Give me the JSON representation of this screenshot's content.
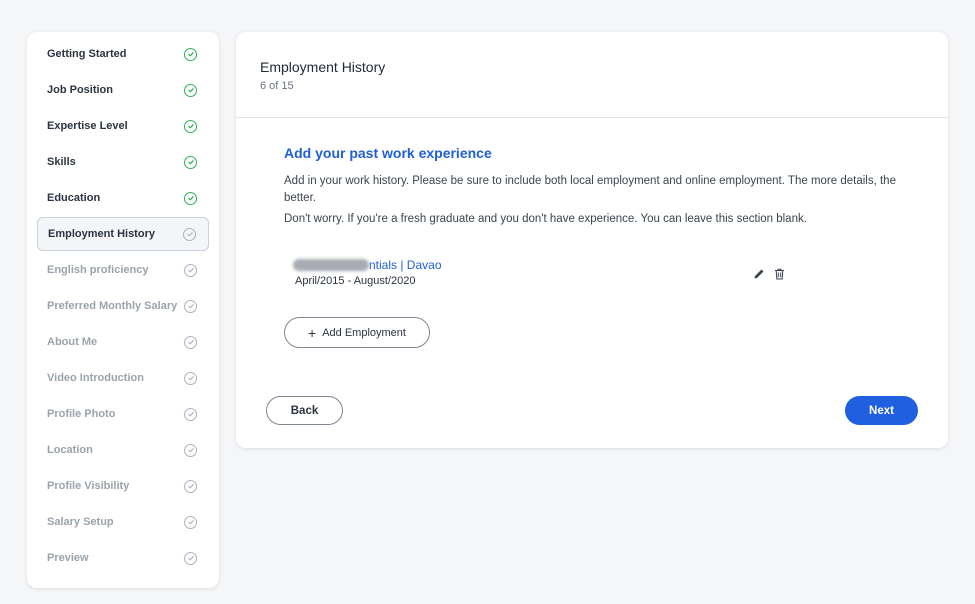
{
  "sidebar": {
    "items": [
      {
        "label": "Getting Started",
        "state": "done"
      },
      {
        "label": "Job Position",
        "state": "done"
      },
      {
        "label": "Expertise Level",
        "state": "done"
      },
      {
        "label": "Skills",
        "state": "done"
      },
      {
        "label": "Education",
        "state": "done"
      },
      {
        "label": "Employment History",
        "state": "active"
      },
      {
        "label": "English proficiency",
        "state": "pending"
      },
      {
        "label": "Preferred Monthly Salary",
        "state": "pending"
      },
      {
        "label": "About Me",
        "state": "pending"
      },
      {
        "label": "Video Introduction",
        "state": "pending"
      },
      {
        "label": "Profile Photo",
        "state": "pending"
      },
      {
        "label": "Location",
        "state": "pending"
      },
      {
        "label": "Profile Visibility",
        "state": "pending"
      },
      {
        "label": "Salary Setup",
        "state": "pending"
      },
      {
        "label": "Preview",
        "state": "pending"
      }
    ]
  },
  "header": {
    "title": "Employment History",
    "step": "6 of 15"
  },
  "main": {
    "section_title": "Add your past work experience",
    "description_1": "Add in your work history. Please be sure to include both local employment and online employment. The more details, the better.",
    "description_2": "Don't worry. If you're a fresh graduate and you don't have experience. You can leave this section blank.",
    "employment": {
      "title_visible": "ntials | Davao",
      "dates": "April/2015 - August/2020"
    },
    "add_button_label": "Add Employment"
  },
  "footer": {
    "back_label": "Back",
    "next_label": "Next"
  },
  "colors": {
    "accent": "#1f5fe0",
    "done_check": "#2fb05a",
    "pending_check": "#aab2bc"
  }
}
